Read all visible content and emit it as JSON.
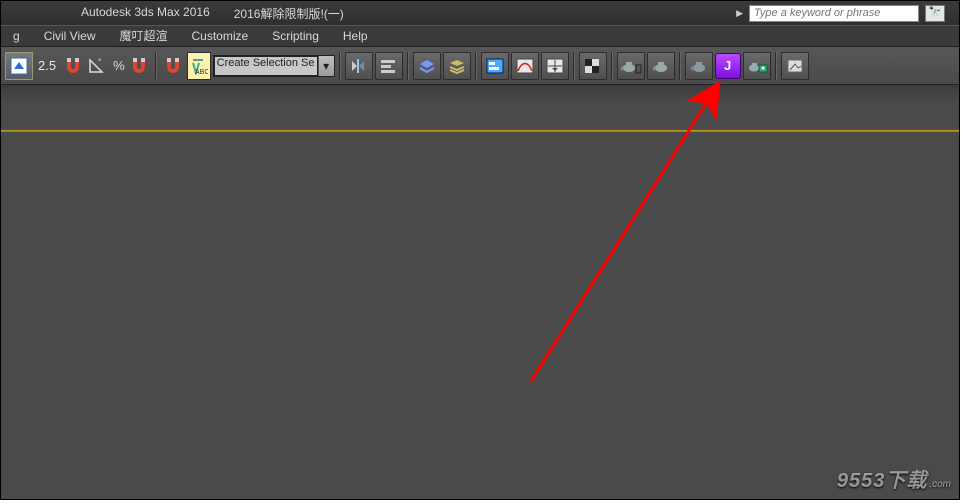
{
  "title": {
    "app": "Autodesk 3ds Max 2016",
    "doc": "2016解除限制版!(一)"
  },
  "search": {
    "placeholder": "Type a keyword or phrase"
  },
  "menu": {
    "items": [
      "g",
      "Civil View",
      "魔叮超渲",
      "Customize",
      "Scripting",
      "Help"
    ]
  },
  "toolbar": {
    "snap_value": "2.5",
    "selection_set": "Create Selection Se"
  },
  "watermark": {
    "text": "9553下载",
    "sub": ".com"
  }
}
